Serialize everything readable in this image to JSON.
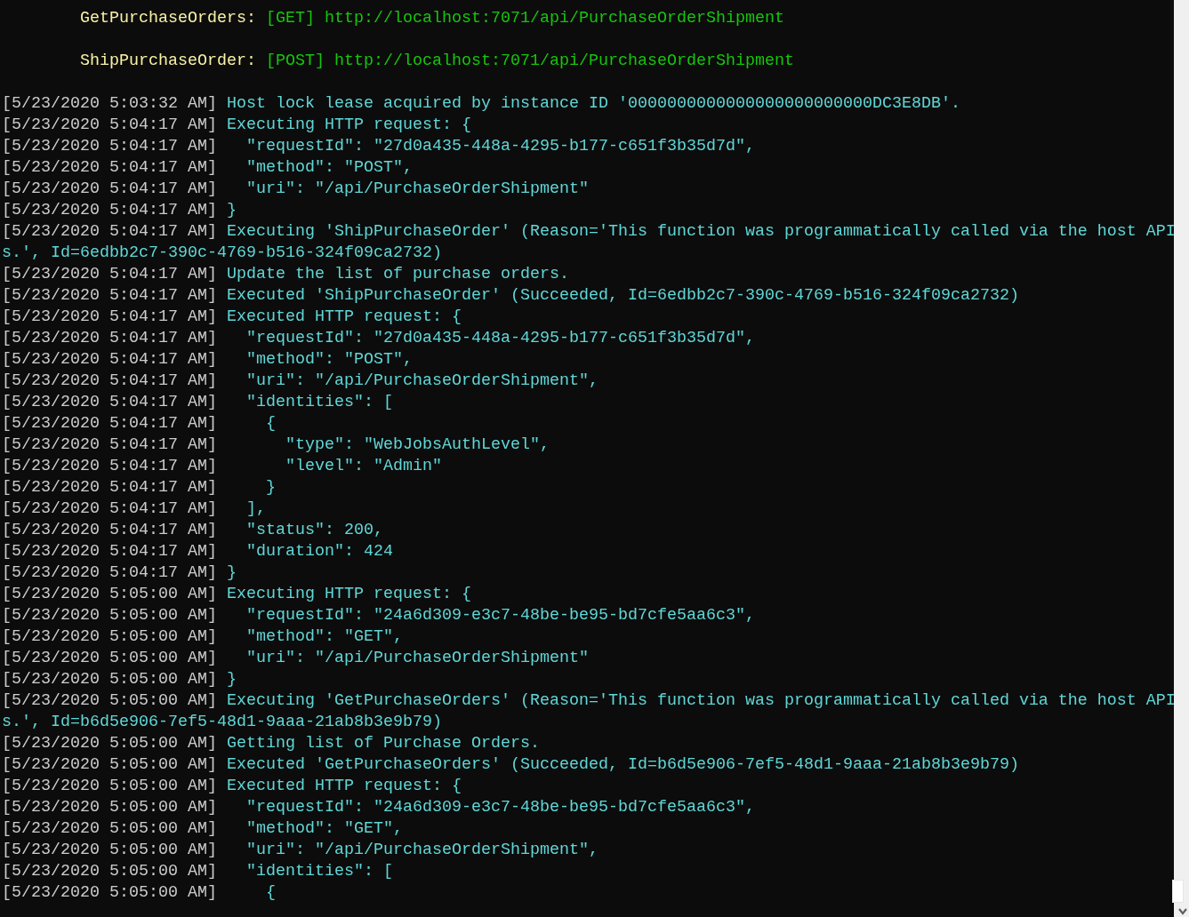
{
  "functions": [
    {
      "name": "GetPurchaseOrders:",
      "method": "[GET]",
      "url": "http://localhost:7071/api/PurchaseOrderShipment"
    },
    {
      "name": "ShipPurchaseOrder:",
      "method": "[POST]",
      "url": "http://localhost:7071/api/PurchaseOrderShipment"
    }
  ],
  "log": [
    {
      "timestamp": "[5/23/2020 5:03:32 AM]",
      "message": "Host lock lease acquired by instance ID '0000000000000000000000000DC3E8DB'."
    },
    {
      "timestamp": "[5/23/2020 5:04:17 AM]",
      "message": "Executing HTTP request: {"
    },
    {
      "timestamp": "[5/23/2020 5:04:17 AM]",
      "message": "  \"requestId\": \"27d0a435-448a-4295-b177-c651f3b35d7d\","
    },
    {
      "timestamp": "[5/23/2020 5:04:17 AM]",
      "message": "  \"method\": \"POST\","
    },
    {
      "timestamp": "[5/23/2020 5:04:17 AM]",
      "message": "  \"uri\": \"/api/PurchaseOrderShipment\""
    },
    {
      "timestamp": "[5/23/2020 5:04:17 AM]",
      "message": "}"
    },
    {
      "timestamp": "[5/23/2020 5:04:17 AM]",
      "message": "Executing 'ShipPurchaseOrder' (Reason='This function was programmatically called via the host APIs.', Id=6edbb2c7-390c-4769-b516-324f09ca2732)"
    },
    {
      "timestamp": "[5/23/2020 5:04:17 AM]",
      "message": "Update the list of purchase orders."
    },
    {
      "timestamp": "[5/23/2020 5:04:17 AM]",
      "message": "Executed 'ShipPurchaseOrder' (Succeeded, Id=6edbb2c7-390c-4769-b516-324f09ca2732)"
    },
    {
      "timestamp": "[5/23/2020 5:04:17 AM]",
      "message": "Executed HTTP request: {"
    },
    {
      "timestamp": "[5/23/2020 5:04:17 AM]",
      "message": "  \"requestId\": \"27d0a435-448a-4295-b177-c651f3b35d7d\","
    },
    {
      "timestamp": "[5/23/2020 5:04:17 AM]",
      "message": "  \"method\": \"POST\","
    },
    {
      "timestamp": "[5/23/2020 5:04:17 AM]",
      "message": "  \"uri\": \"/api/PurchaseOrderShipment\","
    },
    {
      "timestamp": "[5/23/2020 5:04:17 AM]",
      "message": "  \"identities\": ["
    },
    {
      "timestamp": "[5/23/2020 5:04:17 AM]",
      "message": "    {"
    },
    {
      "timestamp": "[5/23/2020 5:04:17 AM]",
      "message": "      \"type\": \"WebJobsAuthLevel\","
    },
    {
      "timestamp": "[5/23/2020 5:04:17 AM]",
      "message": "      \"level\": \"Admin\""
    },
    {
      "timestamp": "[5/23/2020 5:04:17 AM]",
      "message": "    }"
    },
    {
      "timestamp": "[5/23/2020 5:04:17 AM]",
      "message": "  ],"
    },
    {
      "timestamp": "[5/23/2020 5:04:17 AM]",
      "message": "  \"status\": 200,"
    },
    {
      "timestamp": "[5/23/2020 5:04:17 AM]",
      "message": "  \"duration\": 424"
    },
    {
      "timestamp": "[5/23/2020 5:04:17 AM]",
      "message": "}"
    },
    {
      "timestamp": "[5/23/2020 5:05:00 AM]",
      "message": "Executing HTTP request: {"
    },
    {
      "timestamp": "[5/23/2020 5:05:00 AM]",
      "message": "  \"requestId\": \"24a6d309-e3c7-48be-be95-bd7cfe5aa6c3\","
    },
    {
      "timestamp": "[5/23/2020 5:05:00 AM]",
      "message": "  \"method\": \"GET\","
    },
    {
      "timestamp": "[5/23/2020 5:05:00 AM]",
      "message": "  \"uri\": \"/api/PurchaseOrderShipment\""
    },
    {
      "timestamp": "[5/23/2020 5:05:00 AM]",
      "message": "}"
    },
    {
      "timestamp": "[5/23/2020 5:05:00 AM]",
      "message": "Executing 'GetPurchaseOrders' (Reason='This function was programmatically called via the host APIs.', Id=b6d5e906-7ef5-48d1-9aaa-21ab8b3e9b79)"
    },
    {
      "timestamp": "[5/23/2020 5:05:00 AM]",
      "message": "Getting list of Purchase Orders."
    },
    {
      "timestamp": "[5/23/2020 5:05:00 AM]",
      "message": "Executed 'GetPurchaseOrders' (Succeeded, Id=b6d5e906-7ef5-48d1-9aaa-21ab8b3e9b79)"
    },
    {
      "timestamp": "[5/23/2020 5:05:00 AM]",
      "message": "Executed HTTP request: {"
    },
    {
      "timestamp": "[5/23/2020 5:05:00 AM]",
      "message": "  \"requestId\": \"24a6d309-e3c7-48be-be95-bd7cfe5aa6c3\","
    },
    {
      "timestamp": "[5/23/2020 5:05:00 AM]",
      "message": "  \"method\": \"GET\","
    },
    {
      "timestamp": "[5/23/2020 5:05:00 AM]",
      "message": "  \"uri\": \"/api/PurchaseOrderShipment\","
    },
    {
      "timestamp": "[5/23/2020 5:05:00 AM]",
      "message": "  \"identities\": ["
    },
    {
      "timestamp": "[5/23/2020 5:05:00 AM]",
      "message": "    {"
    }
  ]
}
